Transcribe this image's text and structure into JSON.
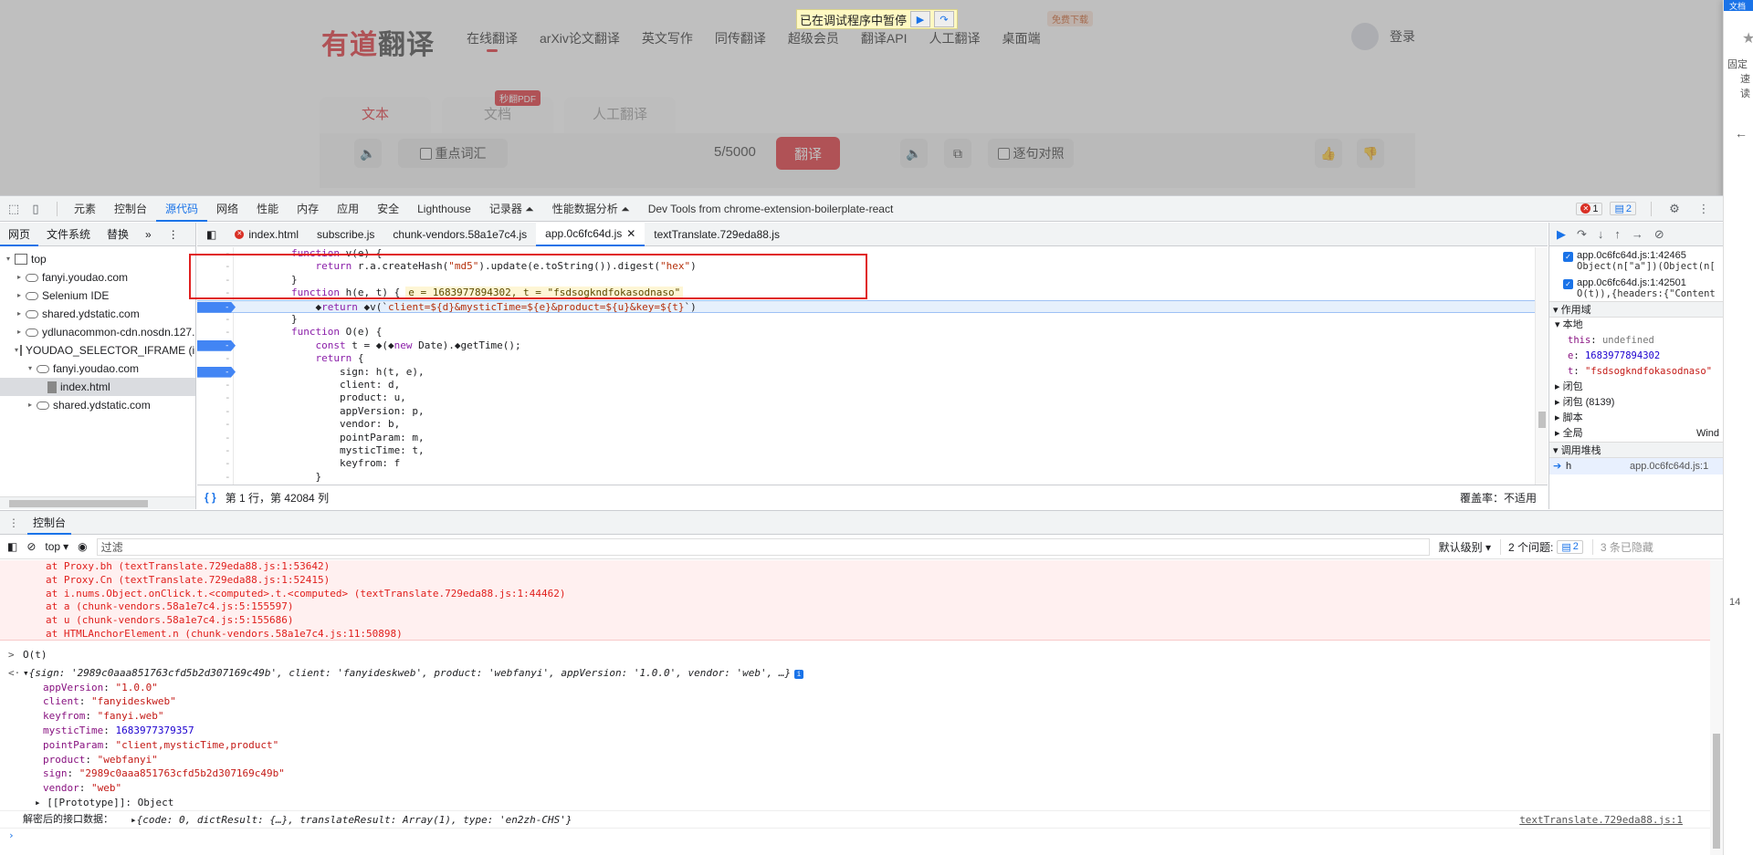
{
  "page": {
    "logo": {
      "red": "有道",
      "black": "翻译"
    },
    "nav": [
      "在线翻译",
      "arXiv论文翻译",
      "英文写作",
      "同传翻译",
      "超级会员",
      "翻译API",
      "人工翻译",
      "桌面端"
    ],
    "download_badge": "免费下载",
    "paused_label": "已在调试程序中暂停",
    "login": "登录",
    "tabs": [
      "文本",
      "文档",
      "人工翻译"
    ],
    "pdf_badge": "秒翻PDF",
    "key_vocab": "重点词汇",
    "char_count": "5/5000",
    "translate_button": "翻译",
    "sentence_compare": "逐句对照"
  },
  "ext": {
    "top": "文档",
    "l1": "固定",
    "l2": "速读",
    "bottom": "14"
  },
  "devtools": {
    "tabs": [
      "元素",
      "控制台",
      "源代码",
      "网络",
      "性能",
      "内存",
      "应用",
      "安全",
      "Lighthouse",
      "记录器 ⏶",
      "性能数据分析 ⏶",
      "Dev Tools from chrome-extension-boilerplate-react"
    ],
    "active_tab": "源代码",
    "error_count": "1",
    "issue_count": "2",
    "navigator": {
      "tabs": [
        "网页",
        "文件系统",
        "替换"
      ],
      "tree": [
        {
          "label": "top",
          "depth": 0,
          "arrow": "▾",
          "icon": "frame"
        },
        {
          "label": "fanyi.youdao.com",
          "depth": 1,
          "arrow": "▸",
          "icon": "cloud"
        },
        {
          "label": "Selenium IDE",
          "depth": 1,
          "arrow": "▸",
          "icon": "cloud"
        },
        {
          "label": "shared.ydstatic.com",
          "depth": 1,
          "arrow": "▸",
          "icon": "cloud"
        },
        {
          "label": "ydlunacommon-cdn.nosdn.127.",
          "depth": 1,
          "arrow": "▸",
          "icon": "cloud"
        },
        {
          "label": "YOUDAO_SELECTOR_IFRAME (in",
          "depth": 1,
          "arrow": "▾",
          "icon": "frame"
        },
        {
          "label": "fanyi.youdao.com",
          "depth": 2,
          "arrow": "▾",
          "icon": "cloud"
        },
        {
          "label": "index.html",
          "depth": 3,
          "arrow": "",
          "icon": "file"
        },
        {
          "label": "shared.ydstatic.com",
          "depth": 2,
          "arrow": "▸",
          "icon": "cloud"
        }
      ]
    },
    "file_tabs": [
      "index.html",
      "subscribe.js",
      "chunk-vendors.58a1e7c4.js",
      "app.0c6fc64d.js",
      "textTranslate.729eda88.js"
    ],
    "active_file": "app.0c6fc64d.js",
    "code": {
      "inline_values": "e = 1683977894302, t = \"fsdsogkndfokasodnaso\""
    },
    "status": {
      "position": "第 1 行，第 42084 列",
      "coverage": "覆盖率：不适用"
    },
    "breakpoints": [
      {
        "loc": "app.0c6fc64d.js:1:42465",
        "src": "Object(n[\"a\"])(Object(n["
      },
      {
        "loc": "app.0c6fc64d.js:1:42501",
        "src": "O(t)),{headers:{\"Content"
      }
    ],
    "scope": {
      "header": "作用域",
      "local": "本地",
      "vars": [
        {
          "name": "this",
          "value": "undefined",
          "kind": "undef"
        },
        {
          "name": "e",
          "value": "1683977894302",
          "kind": "num"
        },
        {
          "name": "t",
          "value": "\"fsdsogkndfokasodnaso\"",
          "kind": "str"
        }
      ],
      "closure": "闭包",
      "closure2": "闭包 (8139)",
      "script": "脚本",
      "global": "全局",
      "global_val": "Wind"
    },
    "callstack": {
      "header": "调用堆栈",
      "fn": "h",
      "loc": "app.0c6fc64d.js:1"
    },
    "drawer": {
      "tab": "控制台",
      "context": "top",
      "filter_placeholder": "过滤",
      "levels": "默认级别 ▾",
      "issues": "2 个问题:",
      "issues_count": "2",
      "hidden": "3 条已隐藏"
    },
    "console": {
      "stack": [
        "at Proxy.bh (textTranslate.729eda88.js:1:53642)",
        "at Proxy.Cn (textTranslate.729eda88.js:1:52415)",
        "at i.nums.Object.onClick.t.<computed>.t.<computed> (textTranslate.729eda88.js:1:44462)",
        "at a (chunk-vendors.58a1e7c4.js:5:155597)",
        "at u (chunk-vendors.58a1e7c4.js:5:155686)",
        "at HTMLAnchorElement.n (chunk-vendors.58a1e7c4.js:11:50898)"
      ],
      "input": "O(t)",
      "summary": "{sign: '2989c0aaa851763cfd5b2d307169c49b', client: 'fanyideskweb', product: 'webfanyi', appVersion: '1.0.0', vendor: 'web', …}",
      "props": [
        {
          "k": "appVersion",
          "v": "\"1.0.0\"",
          "t": "str"
        },
        {
          "k": "client",
          "v": "\"fanyideskweb\"",
          "t": "str"
        },
        {
          "k": "keyfrom",
          "v": "\"fanyi.web\"",
          "t": "str"
        },
        {
          "k": "mysticTime",
          "v": "1683977379357",
          "t": "num"
        },
        {
          "k": "pointParam",
          "v": "\"client,mysticTime,product\"",
          "t": "str"
        },
        {
          "k": "product",
          "v": "\"webfanyi\"",
          "t": "str"
        },
        {
          "k": "sign",
          "v": "\"2989c0aaa851763cfd5b2d307169c49b\"",
          "t": "str"
        },
        {
          "k": "vendor",
          "v": "\"web\"",
          "t": "str"
        }
      ],
      "proto": "[[Prototype]]: Object",
      "decrypt_label": "解密后的接口数据：",
      "decrypt_obj": "{code: 0, dictResult: {…}, translateResult: Array(1), type: 'en2zh-CHS'}",
      "decrypt_src": "textTranslate.729eda88.js:1"
    }
  }
}
